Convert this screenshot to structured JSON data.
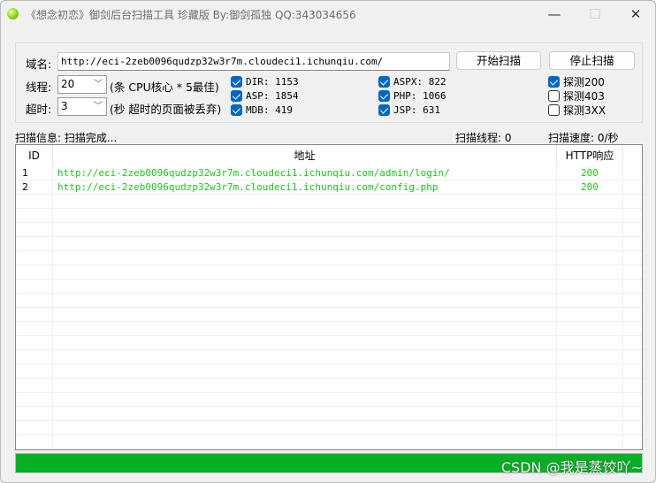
{
  "window": {
    "title": "《想念初恋》御剑后台扫描工具 珍藏版 By:御剑孤独 QQ:343034656",
    "minimize": "—",
    "maximize": "☐",
    "close": "✕"
  },
  "form": {
    "domain_label": "域名:",
    "domain_value": "http://eci-2zeb0096qudzp32w3r7m.cloudeci1.ichunqiu.com/",
    "threads_label": "线程:",
    "threads_value": "20",
    "threads_hint": "(条 CPU核心 * 5最佳)",
    "timeout_label": "超时:",
    "timeout_value": "3",
    "timeout_hint": "(秒 超时的页面被丢弃)",
    "start_button": "开始扫描",
    "stop_button": "停止扫描",
    "dicts": [
      {
        "label": "DIR: 1153",
        "checked": true
      },
      {
        "label": "ASP: 1854",
        "checked": true
      },
      {
        "label": "MDB: 419",
        "checked": true
      },
      {
        "label": "ASPX: 822",
        "checked": true
      },
      {
        "label": "PHP: 1066",
        "checked": true
      },
      {
        "label": "JSP: 631",
        "checked": true
      }
    ],
    "detect": [
      {
        "label": "探测200",
        "checked": true
      },
      {
        "label": "探测403",
        "checked": false
      },
      {
        "label": "探测3XX",
        "checked": false
      }
    ]
  },
  "status": {
    "info": "扫描信息: 扫描完成...",
    "threads": "扫描线程: 0",
    "speed": "扫描速度: 0/秒"
  },
  "table": {
    "headers": [
      "ID",
      "地址",
      "HTTP响应"
    ],
    "rows": [
      {
        "id": "1",
        "url": "http://eci-2zeb0096qudzp32w3r7m.cloudeci1.ichunqiu.com/admin/login/",
        "code": "200"
      },
      {
        "id": "2",
        "url": "http://eci-2zeb0096qudzp32w3r7m.cloudeci1.ichunqiu.com/config.php",
        "code": "200"
      }
    ],
    "result_color": "#22c022"
  },
  "progress": {
    "percent": 100,
    "color": "#06b025"
  },
  "watermark": "CSDN @我是蒸饺吖~"
}
